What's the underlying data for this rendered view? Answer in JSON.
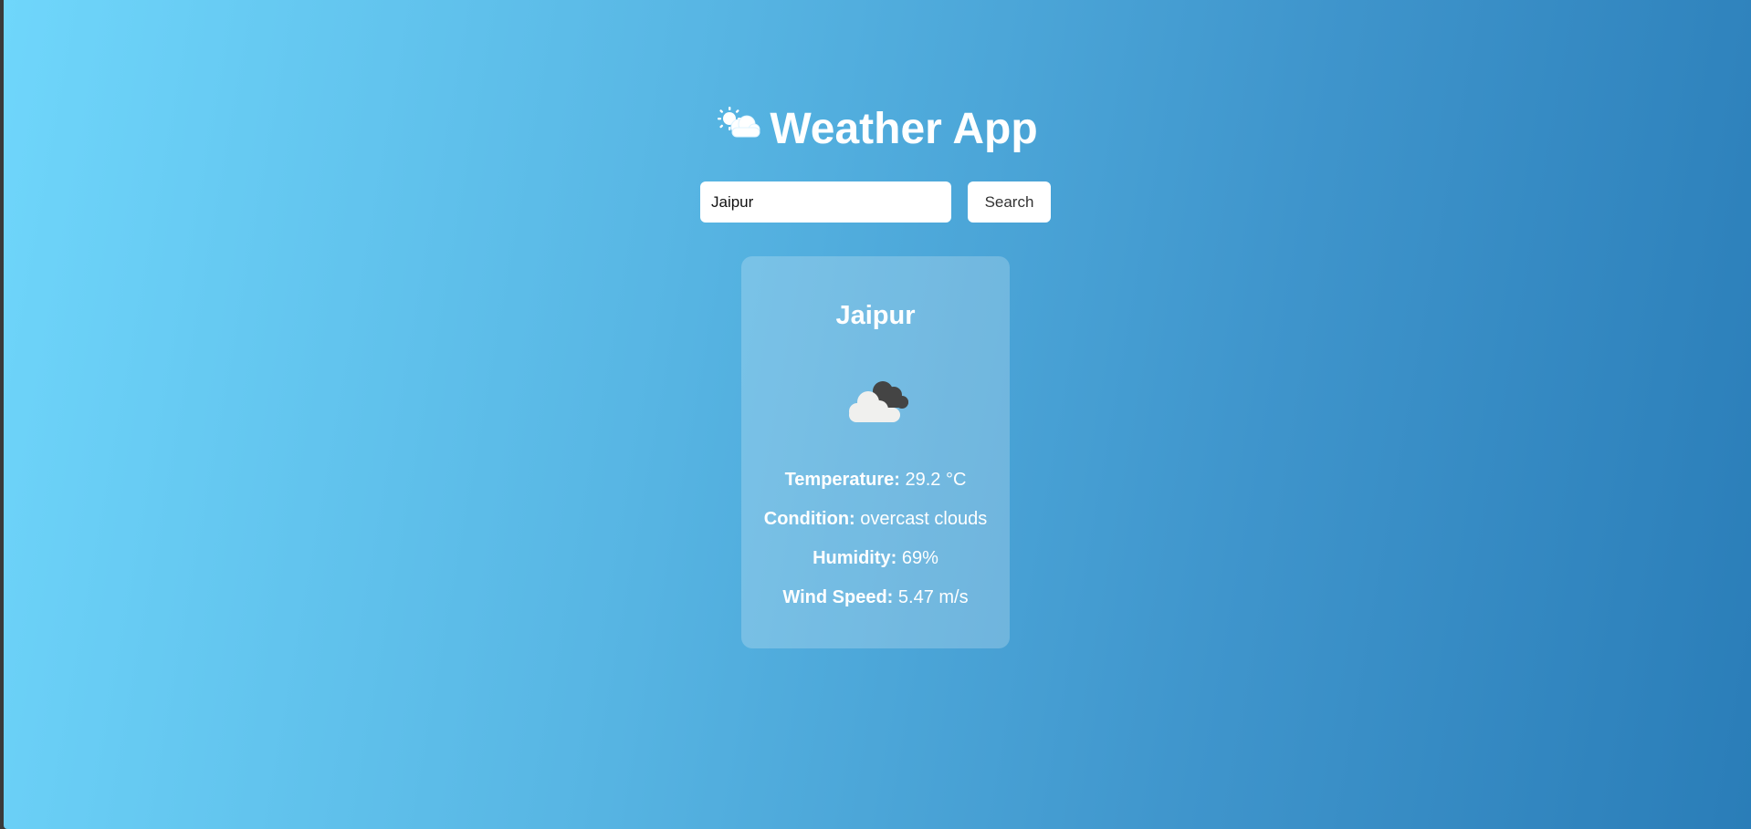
{
  "header": {
    "icon": "sun-behind-cloud-icon",
    "title": "Weather App"
  },
  "search": {
    "value": "Jaipur",
    "placeholder": "",
    "button_label": "Search"
  },
  "weather": {
    "city": "Jaipur",
    "icon": "overcast-clouds-icon",
    "temperature_label": "Temperature:",
    "temperature_value": "29.2 °C",
    "condition_label": "Condition:",
    "condition_value": "overcast clouds",
    "humidity_label": "Humidity:",
    "humidity_value": "69%",
    "wind_label": "Wind Speed:",
    "wind_value": "5.47 m/s"
  },
  "colors": {
    "gradient_start": "#6fd6fb",
    "gradient_end": "#2a7db8",
    "card_background": "rgba(255,255,255,0.22)",
    "text": "#ffffff"
  }
}
